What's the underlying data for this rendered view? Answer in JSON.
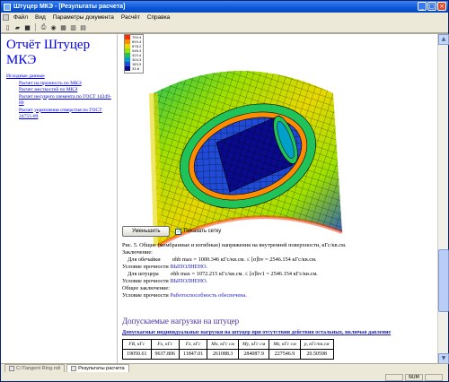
{
  "window": {
    "title": "Штуцер МКЭ - [Результаты расчета]"
  },
  "menu": {
    "items": [
      "Файл",
      "Вид",
      "Параметры документа",
      "Расчёт",
      "Справка"
    ]
  },
  "nav": {
    "title": "Отчёт Штуцер МКЭ",
    "links": [
      "Исходные данные",
      "Расчет на прочность по МКЭ",
      "Расчет жесткостей по МКЭ",
      "Расчет несущего элемента по ГОСТ 14249-89",
      "Расчет укрепления отверстия по ГОСТ 24755-89"
    ]
  },
  "legend": {
    "values": [
      "790.4",
      "659.4",
      "678.2",
      "546.3",
      "425.4",
      "304.3",
      "183.5",
      "33.6"
    ],
    "colors": [
      "#ff2a00",
      "#ff8c00",
      "#e7d800",
      "#9ce000",
      "#1fc35a",
      "#00a0c8",
      "#1f4bd6",
      "#0a0a8c"
    ]
  },
  "controls": {
    "shrink_button": "Уменьшить",
    "show_grid_label": "Показать сетку",
    "show_grid_checked": true
  },
  "report": {
    "figure_caption": "Рис. 5. Общие (мембранные и изгибные) напряжения на внутренней поверхности, кГс/кв.см.",
    "conclusion_label": "Заключение:",
    "shell_prefix": "Для обечайки",
    "shell_sigma": "σhb max",
    "shell_value": "1000.346",
    "shell_allow_sym": "[σ]bv =",
    "shell_allow": "2546.154",
    "unit": "кГс/кв.см.",
    "le": "≤",
    "eq": "=",
    "strength_label": "Условие прочности",
    "strength_result": "ВЫПОЛНЕНО.",
    "nozzle_prefix": "Для штуцера",
    "nozzle_sigma": "σhb max",
    "nozzle_value": "1072.215",
    "nozzle_allow_sym": "[σ]hv1 =",
    "nozzle_allow": "2546.154",
    "overall_label": "Общее заключение:",
    "overall_prefix": "Условие прочности",
    "overall_result": "Работоспособность обеспечена."
  },
  "loads": {
    "heading": "Допускаемые нагрузки на штуцер",
    "table_title": "Допускаемые индивидуальные нагрузки на штуцер при отсутствии действия остальных, включая давление",
    "headers": [
      "FR, кГс",
      "Fx, кГс",
      "Fz, кГс",
      "Mx, кГс см",
      "My, кГс см",
      "Mz, кГс см",
      "p, кГс/кв.см"
    ],
    "values": [
      "19050.61",
      "9637.806",
      "11847.01",
      "261088.3",
      "284087.9",
      "227546.9",
      "20.50598"
    ]
  },
  "tabs": [
    "С:/Tangent Ring.ndi",
    "Результаты расчета"
  ],
  "status": {
    "num": "NUM"
  }
}
